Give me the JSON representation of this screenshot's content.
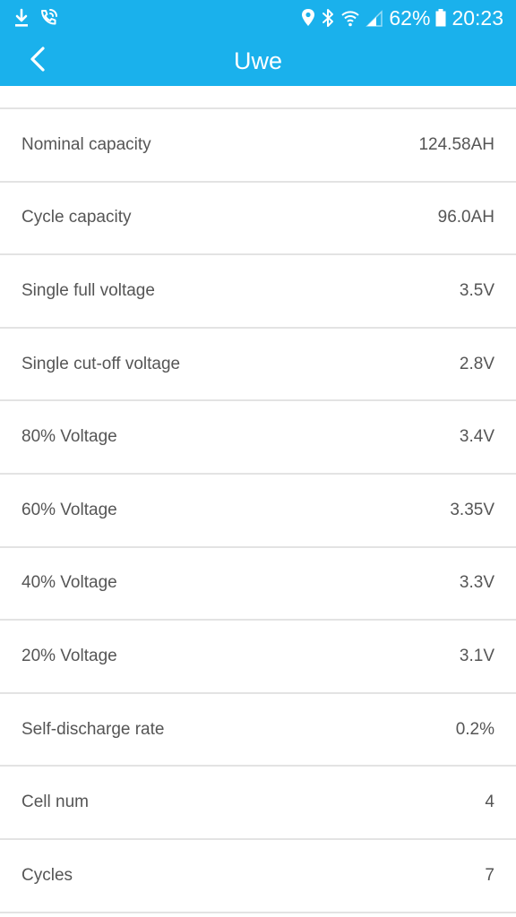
{
  "status_bar": {
    "left_icons": [
      "download-icon",
      "phone-call-icon"
    ],
    "right_icons": [
      "location-icon",
      "bluetooth-icon",
      "wifi-icon",
      "signal-icon",
      "battery-icon"
    ],
    "battery_percent": "62%",
    "time": "20:23"
  },
  "colors": {
    "header_bg": "#1ab1ec",
    "divider": "#e3e3e3",
    "text": "#555555"
  },
  "header": {
    "title": "Uwe",
    "back_icon": "chevron-left-icon"
  },
  "rows": [
    {
      "label": "Nominal capacity",
      "value": "124.58AH"
    },
    {
      "label": "Cycle capacity",
      "value": "96.0AH"
    },
    {
      "label": "Single full voltage",
      "value": "3.5V"
    },
    {
      "label": "Single cut-off voltage",
      "value": "2.8V"
    },
    {
      "label": "80% Voltage",
      "value": "3.4V"
    },
    {
      "label": "60% Voltage",
      "value": "3.35V"
    },
    {
      "label": "40% Voltage",
      "value": "3.3V"
    },
    {
      "label": "20% Voltage",
      "value": "3.1V"
    },
    {
      "label": "Self-discharge rate",
      "value": "0.2%"
    },
    {
      "label": "Cell num",
      "value": "4"
    },
    {
      "label": "Cycles",
      "value": "7"
    }
  ]
}
